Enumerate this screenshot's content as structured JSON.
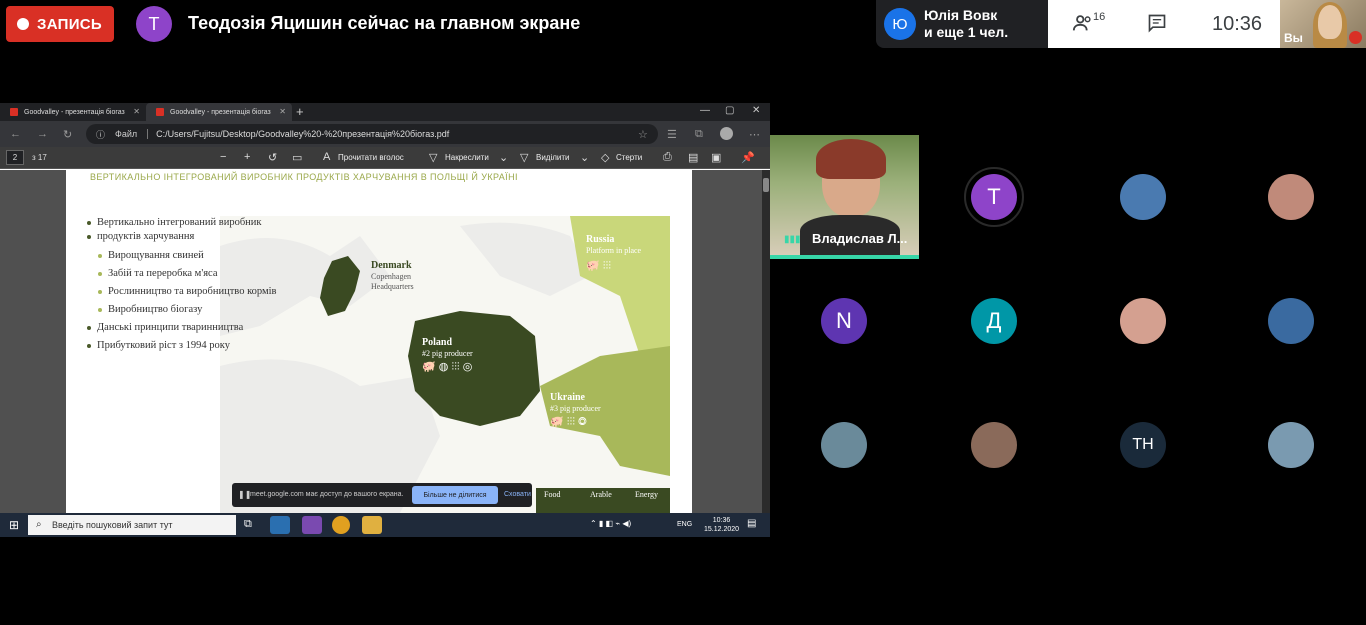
{
  "meet": {
    "record_label": "ЗАПИСЬ",
    "presenter_initial": "Т",
    "presenter_text": "Теодозія Яцишин сейчас на главном экране",
    "pill_initial": "Ю",
    "pill_name": "Юлія Вовк",
    "pill_more": "и еще 1 чел.",
    "people_count": "16",
    "clock": "10:36",
    "self_label": "Вы"
  },
  "browser": {
    "tabs": [
      {
        "label": "Goodvalley - презентація біогаз"
      },
      {
        "label": "Goodvalley - презентація біогаз"
      }
    ],
    "address_label": "Файл",
    "url": "C:/Users/Fujitsu/Desktop/Goodvalley%20-%20презентація%20біогаз.pdf"
  },
  "pdf": {
    "page_number": "2",
    "page_of": "з 17",
    "read_aloud": "Прочитати вголос",
    "draw": "Накреслити",
    "highlight": "Виділити",
    "erase": "Стерти"
  },
  "slide": {
    "title": "ВЕРТИКАЛЬНО ІНТЕГРОВАНИЙ ВИРОБНИК ПРОДУКТІВ ХАРЧУВАННЯ В ПОЛЬЩІ Й УКРАЇНІ",
    "bullets": [
      {
        "text": "Вертикально інтегрований виробник",
        "level": 1
      },
      {
        "text": "продуктів харчування",
        "level": 0
      },
      {
        "text": "Вирощування свиней",
        "level": 2
      },
      {
        "text": "Забій та переробка м'яса",
        "level": 2
      },
      {
        "text": "Рослинництво та виробництво кормів",
        "level": 2
      },
      {
        "text": "Виробництво біогазу",
        "level": 2
      },
      {
        "text": "Данські принципи тваринництва",
        "level": 1
      },
      {
        "text": "Прибутковий ріст з 1994 року",
        "level": 1
      }
    ],
    "denmark": "Denmark",
    "denmark_sub1": "Copenhagen",
    "denmark_sub2": "Headquarters",
    "russia": "Russia",
    "russia_sub": "Platform in place",
    "poland": "Poland",
    "poland_sub": "#2 pig producer",
    "ukraine": "Ukraine",
    "ukraine_sub": "#3 pig producer",
    "legend_food": "Food",
    "legend_arable": "Arable",
    "legend_energy": "Energy"
  },
  "share_bar": {
    "text": "meet.google.com має доступ до вашого екрана.",
    "stop": "Більше не ділитися",
    "hide": "Сховати"
  },
  "taskbar": {
    "search_placeholder": "Введіть пошуковий запит тут",
    "lang": "ENG",
    "time": "10:36",
    "date": "15.12.2020"
  },
  "grid": {
    "presenter_tile_name": "Владислав Л...",
    "avatars": [
      {
        "initial": "Т",
        "color": "#8e44c9"
      },
      {
        "initial": "",
        "color": "#4a7ab0"
      },
      {
        "initial": "",
        "color": "#c08a7a"
      },
      {
        "initial": "N",
        "color": "#5e35b1"
      },
      {
        "initial": "Д",
        "color": "#0097a7"
      },
      {
        "initial": "",
        "color": "#d4a090"
      },
      {
        "initial": "",
        "color": "#3a6aa0"
      },
      {
        "initial": "",
        "color": "#6a8a9a"
      },
      {
        "initial": "",
        "color": "#8a6a5a"
      },
      {
        "initial": "ТН",
        "color": "#1a2a3a"
      },
      {
        "initial": "",
        "color": "#7a9ab0"
      }
    ]
  }
}
